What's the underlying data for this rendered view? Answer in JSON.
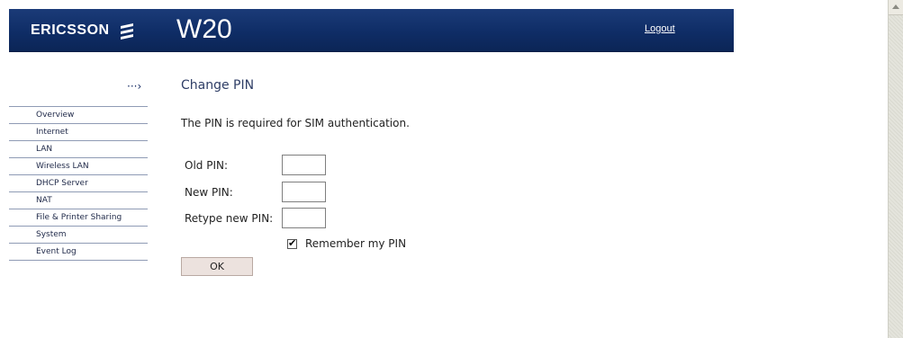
{
  "header": {
    "brand": "ERICSSON",
    "brand_logo_icon": "ericsson-logo-icon",
    "product": "W20",
    "logout_label": "Logout",
    "bg_color": "#0f2d66"
  },
  "sidebar": {
    "arrow_icon": "···›",
    "items": [
      {
        "label": "Overview"
      },
      {
        "label": "Internet"
      },
      {
        "label": "LAN"
      },
      {
        "label": "Wireless LAN"
      },
      {
        "label": "DHCP Server"
      },
      {
        "label": "NAT"
      },
      {
        "label": "File & Printer Sharing"
      },
      {
        "label": "System"
      },
      {
        "label": "Event Log"
      }
    ]
  },
  "main": {
    "title": "Change PIN",
    "description": "The PIN is required for SIM authentication.",
    "fields": [
      {
        "label": "Old PIN:",
        "value": ""
      },
      {
        "label": "New PIN:",
        "value": ""
      },
      {
        "label": "Retype new PIN:",
        "value": ""
      }
    ],
    "remember": {
      "label": "Remember my PIN",
      "checked": true,
      "tick": "✔"
    },
    "ok_label": "OK"
  }
}
